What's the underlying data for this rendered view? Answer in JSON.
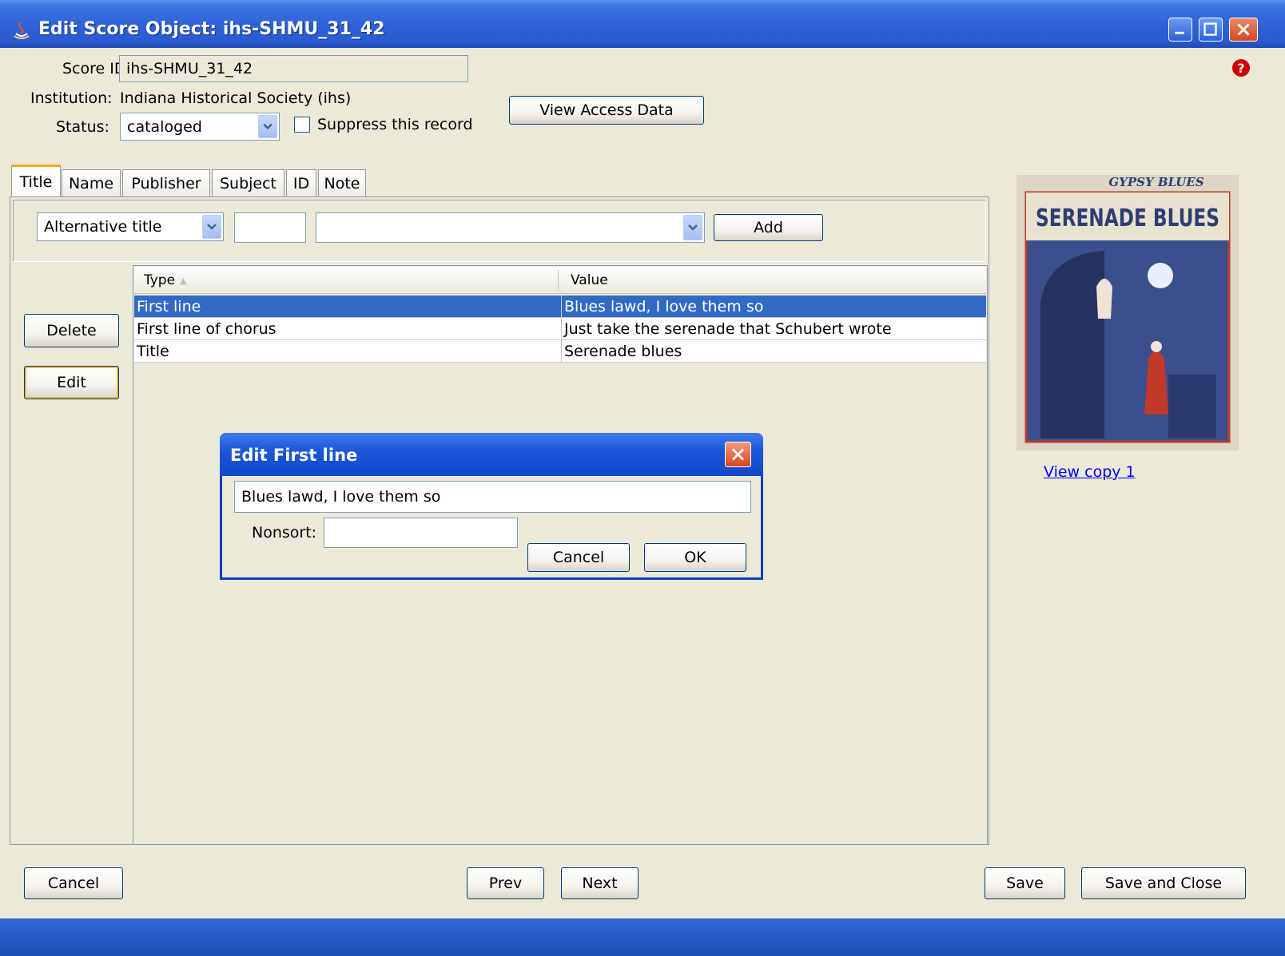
{
  "window": {
    "title": "Edit Score Object: ihs-SHMU_31_42"
  },
  "header": {
    "score_id_label": "Score ID:",
    "score_id_value": "ihs-SHMU_31_42",
    "institution_label": "Institution:",
    "institution_value": "Indiana Historical Society (ihs)",
    "status_label": "Status:",
    "status_value": "cataloged",
    "suppress_label": "Suppress this record",
    "suppress_checked": false,
    "view_access_button": "View Access Data"
  },
  "tabs": [
    "Title",
    "Name",
    "Publisher",
    "Subject",
    "ID",
    "Note"
  ],
  "active_tab": "Title",
  "add_bar": {
    "type_select": "Alternative title",
    "nonsort_value": "",
    "value_select": "",
    "add_button": "Add"
  },
  "side_buttons": {
    "delete": "Delete",
    "edit": "Edit"
  },
  "table": {
    "columns": [
      "Type",
      "Value"
    ],
    "rows": [
      {
        "type": "First line",
        "value": "Blues lawd, I love them so",
        "selected": true
      },
      {
        "type": "First line of chorus",
        "value": "Just take the serenade that Schubert wrote",
        "selected": false
      },
      {
        "type": "Title",
        "value": "Serenade blues",
        "selected": false
      }
    ]
  },
  "dialog": {
    "title": "Edit First line",
    "text_value": "Blues lawd, I love them so",
    "nonsort_label": "Nonsort:",
    "nonsort_value": "",
    "cancel_button": "Cancel",
    "ok_button": "OK"
  },
  "thumbnail": {
    "top_text": "GYPSY BLUES",
    "main_text": "SERENADE BLUES",
    "view_link": "View copy 1"
  },
  "footer": {
    "cancel": "Cancel",
    "prev": "Prev",
    "next": "Next",
    "save": "Save",
    "save_close": "Save and Close"
  },
  "colors": {
    "titlebar": "#2f62d6",
    "window_bg": "#ece9d8",
    "selection": "#316ac5",
    "link": "#0000ff",
    "help_icon": "#cc0000"
  }
}
